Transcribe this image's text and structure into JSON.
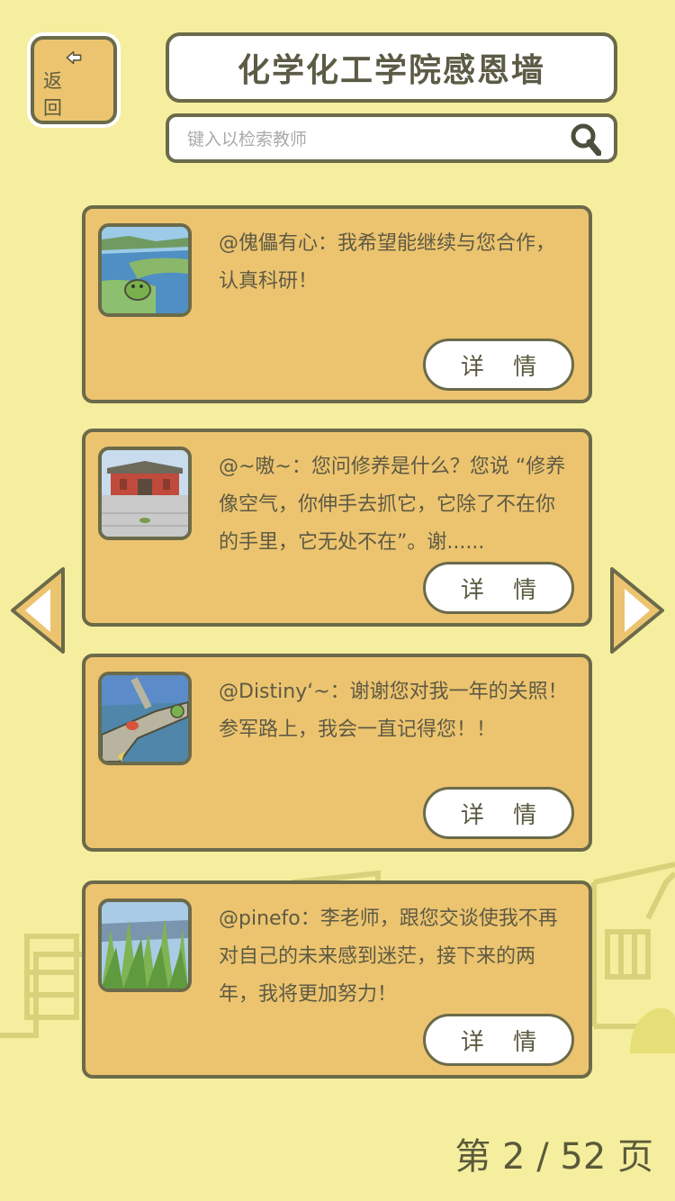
{
  "header": {
    "back_label": "返 回",
    "title": "化学化工学院感恩墙"
  },
  "search": {
    "placeholder": "键入以检索教师",
    "value": ""
  },
  "cards": [
    {
      "text": "@傀儡有心：我希望能继续与您合作，认真科研！",
      "detail_label": "详 情"
    },
    {
      "text": "@~嗷~：您问修养是什么？您说 “修养像空气，你伸手去抓它，它除了不在你的手里，它无处不在”。谢......",
      "detail_label": "详 情"
    },
    {
      "text": "@Distiny‘~：谢谢您对我一年的关照！参军路上，我会一直记得您！！",
      "detail_label": "详 情"
    },
    {
      "text": "@pinefo：李老师，跟您交谈使我不再对自己的未来感到迷茫，接下来的两年，我将更加努力！",
      "detail_label": "详 情"
    }
  ],
  "pagination": {
    "text": "第 2 / 52 页"
  },
  "icons": {
    "back": "arrow-left-icon",
    "search": "magnifier-icon",
    "prev": "prev-page-arrow-icon",
    "next": "next-page-arrow-icon"
  },
  "colors": {
    "background": "#f5ee9e",
    "card": "#ecc46f",
    "border": "#6b6a4a"
  }
}
